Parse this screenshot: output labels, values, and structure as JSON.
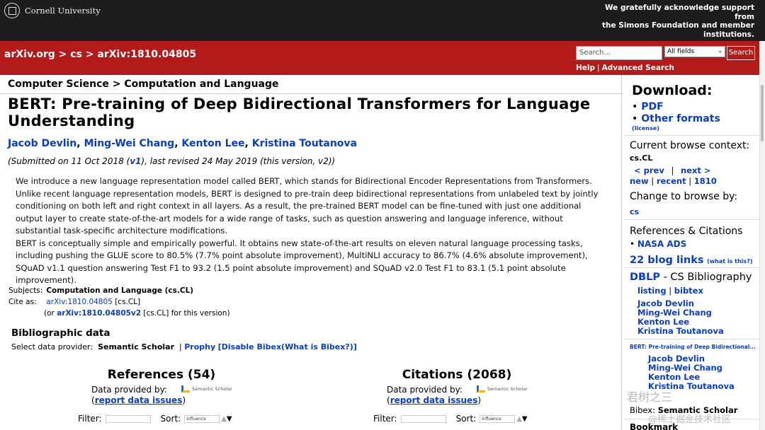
{
  "topbar": {
    "university": "Cornell University",
    "acknowledgement_lines": [
      "We gratefully acknowledge support",
      "from",
      "the Simons Foundation and member",
      "institutions."
    ]
  },
  "header": {
    "breadcrumb": [
      "arXiv.org",
      "cs",
      "arXiv:1810.04805"
    ],
    "breadcrumb_sep": ">",
    "search_placeholder": "Search...",
    "search_field": "All fields",
    "search_button": "Search",
    "help": "Help",
    "advanced_search": "Advanced Search"
  },
  "main": {
    "subject_heading": "Computer Science > Computation and Language",
    "title": "BERT: Pre-training of Deep Bidirectional Transformers for Language Understanding",
    "authors": [
      "Jacob Devlin",
      "Ming-Wei Chang",
      "Kenton Lee",
      "Kristina Toutanova"
    ],
    "dateline_pre": "(Submitted on 11 Oct 2018 (",
    "dateline_v1": "v1",
    "dateline_post": "), last revised 24 May 2019 (this version, v2))",
    "abstract_p1": "We introduce a new language representation model called BERT, which stands for Bidirectional Encoder Representations from Transformers. Unlike recent language representation models, BERT is designed to pre-train deep bidirectional representations from unlabeled text by jointly conditioning on both left and right context in all layers. As a result, the pre-trained BERT model can be fine-tuned with just one additional output layer to create state-of-the-art models for a wide range of tasks, such as question answering and language inference, without substantial task-specific architecture modifications.",
    "abstract_p2": "BERT is conceptually simple and empirically powerful. It obtains new state-of-the-art results on eleven natural language processing tasks, including pushing the GLUE score to 80.5% (7.7% point absolute improvement), MultiNLI accuracy to 86.7% (4.6% absolute improvement), SQuAD v1.1 question answering Test F1 to 93.2 (1.5 point absolute improvement) and SQuAD v2.0 Test F1 to 83.1 (5.1 point absolute improvement).",
    "subjects_label": "Subjects:",
    "subjects_value": "Computation and Language (cs.CL)",
    "cite_label": "Cite as:",
    "cite_id": "arXiv:1810.04805",
    "cite_cat": " [cs.CL]",
    "cite2_pre": "(or ",
    "cite2_id": "arXiv:1810.04805v2",
    "cite2_post": " [cs.CL] for this version)",
    "bib_heading": "Bibliographic data",
    "bib_provider_pre": "Select data provider:",
    "bib_provider": "Semantic Scholar",
    "bib_sep": "|",
    "bib_prophy": "Prophy",
    "bib_disable": "[Disable Bibex(",
    "bib_what": "What is Bibex?",
    "bib_close": ")]",
    "references_head": "References (54)",
    "citations_head": "Citations (2068)",
    "data_provided_by": "Data provided by:",
    "report_issues": "report data issues",
    "paren_open": "(",
    "paren_close": ")",
    "ss_logo_text": "Semantic Scholar",
    "filter_label": "Filter:",
    "sort_label": "Sort:",
    "sort_value": "Influence"
  },
  "sidebar": {
    "download_head": "Download:",
    "pdf": "PDF",
    "other_formats": "Other formats",
    "license": "(license)",
    "browse_context_label": "Current browse context:",
    "browse_context": "cs.CL",
    "prev": "< prev",
    "next": "next >",
    "new": "new",
    "recent": "recent",
    "month": "1810",
    "pipe": "|",
    "change_browse": "Change to browse by:",
    "cs": "cs",
    "refcite_head": "References & Citations",
    "nasa": "NASA ADS",
    "blog_links": "22 blog links",
    "blog_what": "(what is this?)",
    "dblp": "DBLP",
    "dblp_rest": " - CS Bibliography",
    "listing": "listing",
    "bibtex": "bibtex",
    "dblp_authors": [
      "Jacob Devlin",
      "Ming-Wei Chang",
      "Kenton Lee",
      "Kristina Toutanova"
    ],
    "paper_short": "BERT: Pre-training of Deep Bidirectional...",
    "paper_authors": [
      "Jacob Devlin",
      "Ming-Wei Chang",
      "Kenton Lee",
      "Kristina Toutanova"
    ],
    "bibex_label": "Bibex:",
    "bibex_value": "Semantic Scholar",
    "bookmark": "Bookmark"
  },
  "watermark": {
    "line1": "君树之三",
    "line2": "@稀土掘金技术社区"
  }
}
